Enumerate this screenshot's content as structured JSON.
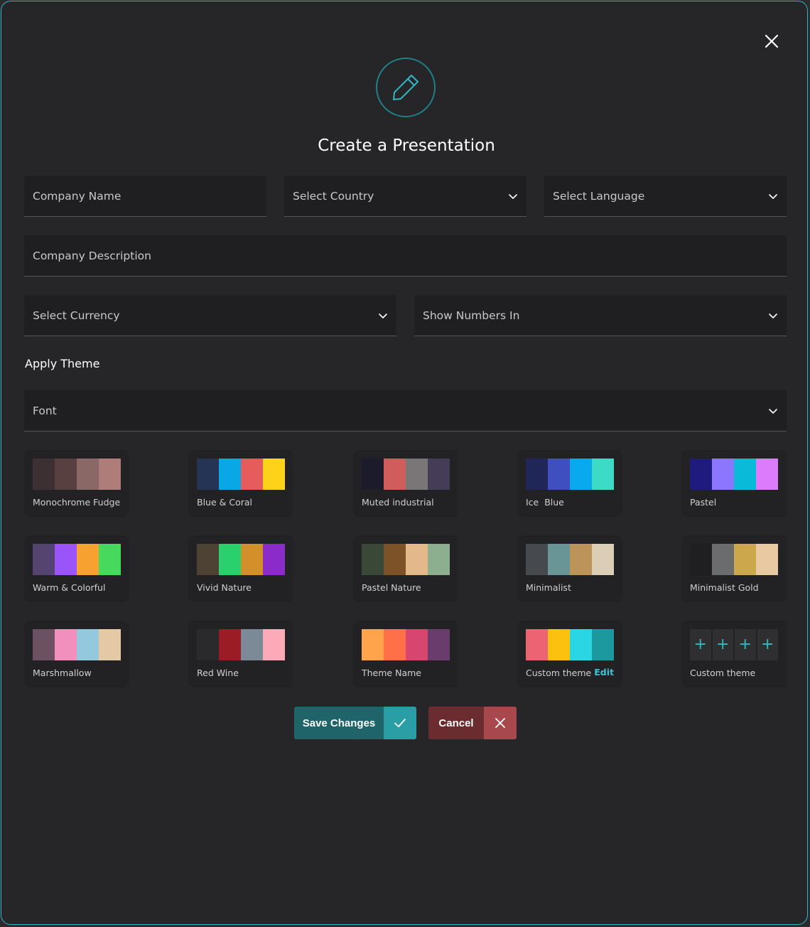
{
  "modal": {
    "title": "Create a Presentation"
  },
  "form": {
    "company_name_placeholder": "Company Name",
    "country_placeholder": "Select Country",
    "language_placeholder": "Select Language",
    "description_placeholder": "Company Description",
    "currency_placeholder": "Select Currency",
    "numbers_placeholder": "Show Numbers In",
    "apply_theme_label": "Apply Theme",
    "font_placeholder": "Font"
  },
  "themes": [
    {
      "name": "Monochrome Fudge",
      "colors": [
        "#3d3033",
        "#57403f",
        "#8a6865",
        "#ae7d7a"
      ]
    },
    {
      "name": "Blue & Coral",
      "colors": [
        "#253355",
        "#0aa7e6",
        "#e65b5b",
        "#ffd21a"
      ]
    },
    {
      "name": "Muted industrial",
      "colors": [
        "#1b1b2c",
        "#d05c5b",
        "#7a7677",
        "#453d58"
      ]
    },
    {
      "name": "Ice  Blue",
      "colors": [
        "#202658",
        "#3f4fc0",
        "#08a9ee",
        "#3ddac6"
      ]
    },
    {
      "name": "Pastel",
      "colors": [
        "#1f1a7e",
        "#8b76fd",
        "#09bbd8",
        "#dd7bfd"
      ]
    },
    {
      "name": "Warm & Colorful",
      "colors": [
        "#54446f",
        "#9a54f7",
        "#f7a230",
        "#47d85e"
      ]
    },
    {
      "name": "Vivid Nature",
      "colors": [
        "#4e4234",
        "#2ad06c",
        "#d28f2a",
        "#8b2bc9"
      ]
    },
    {
      "name": "Pastel Nature",
      "colors": [
        "#3a4937",
        "#7c5328",
        "#e3b88a",
        "#8eaf8f"
      ]
    },
    {
      "name": "Minimalist",
      "colors": [
        "#46494d",
        "#6a9596",
        "#bc9459",
        "#dbcdb6"
      ]
    },
    {
      "name": "Minimalist Gold",
      "colors": [
        "#1f1f22",
        "#6b6c6e",
        "#cca84d",
        "#e8c9a2"
      ]
    },
    {
      "name": "Marshmallow",
      "colors": [
        "#6c5163",
        "#f18fbd",
        "#94c9dd",
        "#e5c9a5"
      ]
    },
    {
      "name": "Red Wine",
      "colors": [
        "#2a2a2c",
        "#9b1c24",
        "#7b8a96",
        "#fcaab7"
      ]
    },
    {
      "name": "Theme Name",
      "colors": [
        "#ffa44b",
        "#ff7049",
        "#d6466f",
        "#6a3c6b"
      ]
    },
    {
      "name": "Custom theme",
      "colors": [
        "#ec6473",
        "#fcc10f",
        "#2ad6e4",
        "#1b999f"
      ],
      "action": "Edit"
    },
    {
      "name": "Custom theme",
      "placeholder_cells": [
        "+",
        "+",
        "+",
        "+"
      ]
    }
  ],
  "actions": {
    "save_label": "Save Changes",
    "cancel_label": "Cancel"
  },
  "colors": {
    "accent": "#33b5c4",
    "save_bg": "#1e6468",
    "save_icon_bg": "#2a9ea5",
    "cancel_bg": "#6b2c30",
    "cancel_icon_bg": "#a8474c"
  },
  "icons": [
    "close-icon",
    "pencil-icon",
    "chevron-down-icon",
    "check-icon",
    "x-icon",
    "plus-icon"
  ]
}
